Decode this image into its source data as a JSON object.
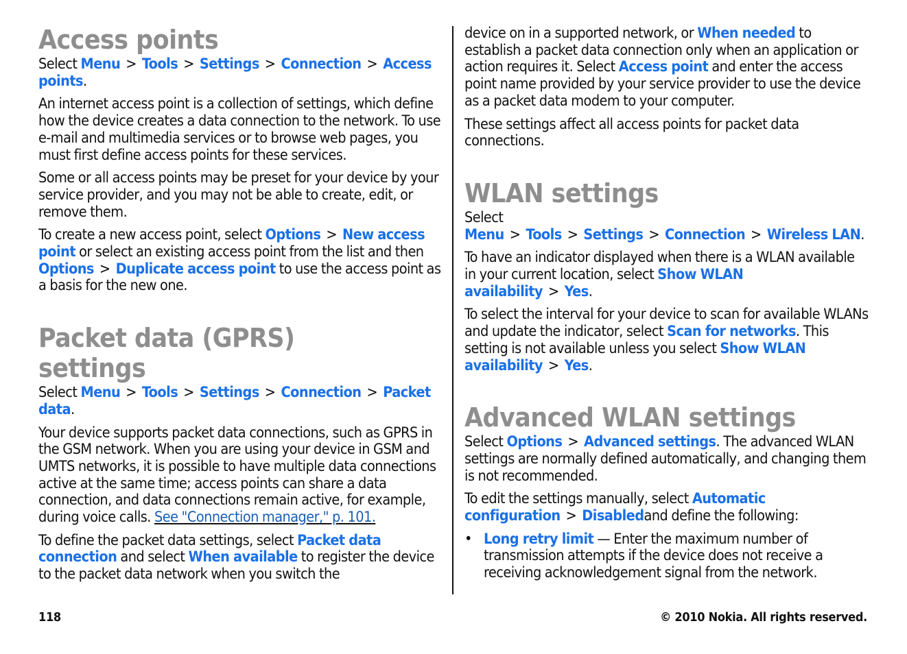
{
  "left": {
    "access_points": {
      "heading": "Access points",
      "path": {
        "select": "Select",
        "items": [
          "Menu",
          "Tools",
          "Settings",
          "Connection",
          "Access points"
        ],
        "end": "."
      },
      "p1": "An internet access point is a collection of settings, which define how the device creates a data connection to the network. To use e-mail and multimedia services or to browse web pages, you must first define access points for these services.",
      "p2": "Some or all access points may be preset for your device by your service provider, and you may not be able to create, edit, or remove them.",
      "p3": {
        "t1": "To create a new access point, select",
        "l1": "Options",
        "l2": "New access point",
        "t2": "or select an existing access point from the list and then",
        "l3": "Options",
        "l4": "Duplicate access point",
        "t3": "to use the access point as a basis for the new one."
      }
    },
    "packet_data": {
      "heading": "Packet data (GPRS) settings",
      "path": {
        "select": "Select",
        "items": [
          "Menu",
          "Tools",
          "Settings",
          "Connection",
          "Packet data"
        ],
        "end": "."
      },
      "p1": {
        "text": "Your device supports packet data connections, such as GPRS in the GSM network. When you are using your device in GSM and UMTS networks, it is possible to have multiple data connections active at the same time; access points can share a data connection, and data connections remain active, for example, during voice calls.",
        "xref": "See \"Connection manager,\" p. 101."
      },
      "p2": {
        "t1": "To define the packet data settings, select",
        "l1": "Packet data connection",
        "t2": "and select",
        "l2": "When available",
        "t3": "to register the device to the packet data network when you switch the"
      }
    }
  },
  "right": {
    "cont": {
      "t1": "device on in a supported network, or",
      "l1": "When needed",
      "t2": "to establish a packet data connection only when an application or action requires it. Select",
      "l2": "Access point",
      "t3": "and enter the access point name provided by your service provider to use the device as a packet data modem to your computer."
    },
    "cont2": "These settings affect all access points for packet data connections.",
    "wlan": {
      "heading": "WLAN settings",
      "path": {
        "select": "Select",
        "items": [
          "Menu",
          "Tools",
          "Settings",
          "Connection",
          "Wireless LAN"
        ],
        "end": "."
      },
      "p1": {
        "t1": "To have an indicator displayed when there is a WLAN available in your current location, select",
        "l1": "Show WLAN availability",
        "l2": "Yes",
        "end": "."
      },
      "p2": {
        "t1": "To select the interval for your device to scan for available WLANs and update the indicator, select",
        "l1": "Scan for networks",
        "t2": ". This setting is not available unless you select",
        "l2": "Show WLAN availability",
        "l3": "Yes",
        "end": "."
      }
    },
    "adv": {
      "heading": "Advanced WLAN settings",
      "p1": {
        "select": "Select",
        "l1": "Options",
        "l2": "Advanced settings",
        "t1": ". The advanced WLAN settings are normally defined automatically, and changing them is not recommended."
      },
      "p2": {
        "t1": "To edit the settings manually, select",
        "l1": "Automatic configuration",
        "l2": "Disabled",
        "t2": "and define the following:"
      },
      "bullets": [
        {
          "label": "Long retry limit",
          "text": " — Enter the maximum number of transmission attempts if the device does not receive a receiving acknowledgement signal from the network."
        }
      ]
    }
  },
  "separator": ">",
  "bullet_glyph": "•",
  "footer": {
    "page_number": "118",
    "copyright": "© 2010 Nokia. All rights reserved."
  },
  "colors": {
    "link": "#1a70e6",
    "heading": "#8e8e8e",
    "text": "#111111"
  }
}
